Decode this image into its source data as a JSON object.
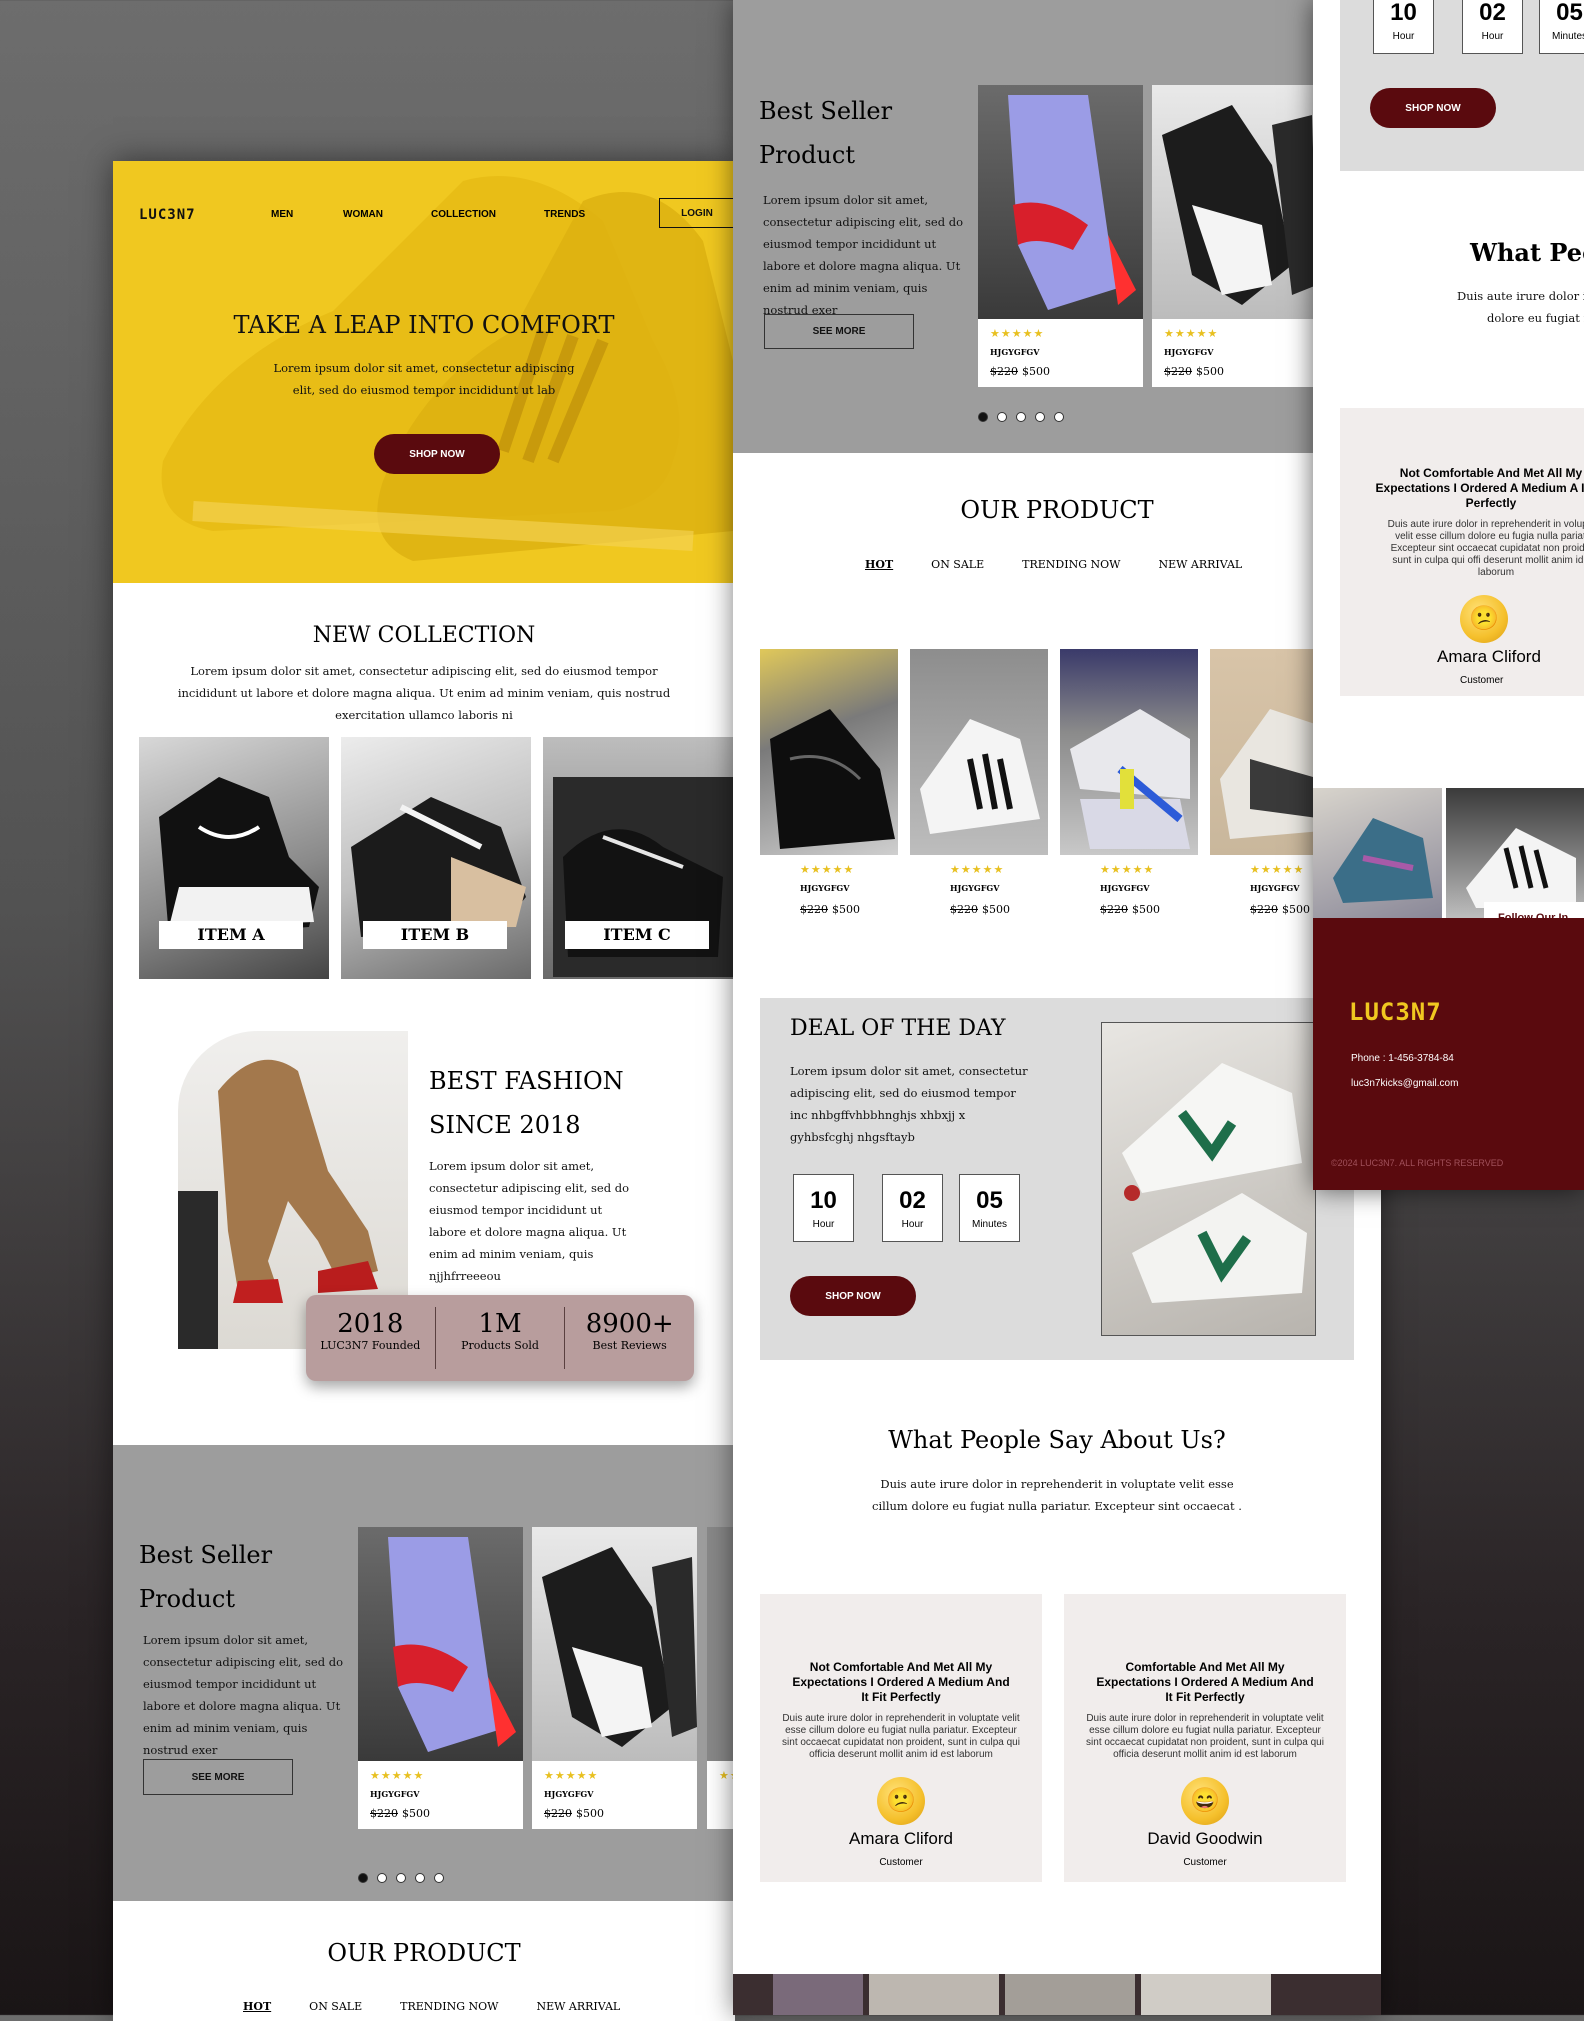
{
  "colors": {
    "accent": "#5a0a0e",
    "hero": "#f0c820",
    "gray": "#9d9d9d",
    "stats": "#b89d9d"
  },
  "brand": "LUC3N7",
  "nav": {
    "items": [
      "MEN",
      "WOMAN",
      "COLLECTION",
      "TRENDS"
    ],
    "login": "LOGIN"
  },
  "hero": {
    "title": "TAKE A LEAP INTO COMFORT",
    "text": "Lorem ipsum dolor sit amet, consectetur adipiscing elit, sed do eiusmod tempor incididunt ut lab",
    "cta": "SHOP NOW"
  },
  "collection": {
    "title": "NEW COLLECTION",
    "text": "Lorem ipsum dolor sit amet, consectetur adipiscing elit, sed do eiusmod tempor incididunt ut labore et dolore magna aliqua. Ut enim ad minim veniam, quis nostrud exercitation ullamco laboris ni",
    "items": [
      "ITEM A",
      "ITEM B",
      "ITEM C"
    ]
  },
  "fashion": {
    "title1": "BEST FASHION",
    "title2": "SINCE 2018",
    "text": "Lorem ipsum dolor sit amet, consectetur adipiscing elit, sed do eiusmod tempor incididunt ut labore et dolore magna aliqua. Ut enim ad minim veniam, quis njjhfrreeeou",
    "stats": [
      {
        "value": "2018",
        "label": "LUC3N7 Founded"
      },
      {
        "value": "1M",
        "label": "Products Sold"
      },
      {
        "value": "8900+",
        "label": "Best Reviews"
      }
    ]
  },
  "bestseller": {
    "title1": "Best Seller",
    "title2": "Product",
    "text": "Lorem ipsum dolor sit amet, consectetur adipiscing elit, sed do eiusmod tempor incididunt ut labore et dolore magna aliqua. Ut enim ad minim veniam, quis nostrud exer",
    "more": "SEE MORE",
    "code": "HJGYGFGV",
    "old_price": "$220",
    "price": "$500",
    "stars": "★★★★★"
  },
  "product": {
    "title": "OUR PRODUCT",
    "tabs": [
      "HOT",
      "ON SALE",
      "TRENDING NOW",
      "NEW ARRIVAL"
    ],
    "code": "HJGYGFGV",
    "old_price": "$220",
    "price": "$500"
  },
  "deal": {
    "title": "DEAL OF THE DAY",
    "text": "Lorem ipsum dolor sit amet, consectetur adipiscing elit, sed do eiusmod tempor inc nhbgffvhbbhnghjs  xhbxjj x gyhbsfcghj nhgsftayb",
    "timer": [
      {
        "value": "10",
        "label": "Hour"
      },
      {
        "value": "02",
        "label": "Hour"
      },
      {
        "value": "05",
        "label": "Minutes"
      }
    ],
    "cta": "SHOP NOW"
  },
  "reviews": {
    "title": "What People Say About Us?",
    "title_partial": "What Peo",
    "text": "Duis aute irure dolor in reprehenderit in voluptate velit esse cillum dolore eu fugiat nulla pariatur. Excepteur sint occaecat .",
    "text_partial1": "Duis aute irure dolor in",
    "text_partial2": "dolore eu fugiat nu",
    "items": [
      {
        "heading": "Not Comfortable And Met All My Expectations I Ordered A Medium And It Fit Perfectly",
        "body": "Duis aute irure dolor in reprehenderit in voluptate velit esse cillum dolore eu fugiat nulla pariatur. Excepteur sint occaecat cupidatat non proident, sunt in culpa qui officia deserunt mollit anim id est laborum",
        "name": "Amara Cliford",
        "role": "Customer",
        "face": "confused-face-icon"
      },
      {
        "heading": "Comfortable And Met All My Expectations I Ordered A Medium And It Fit Perfectly",
        "body": "Duis aute irure dolor in reprehenderit in voluptate velit esse cillum dolore eu fugiat nulla pariatur. Excepteur sint occaecat cupidatat non proident, sunt in culpa qui officia deserunt mollit anim id est laborum",
        "name": "David Goodwin",
        "role": "Customer",
        "face": "smiling-face-icon"
      }
    ],
    "partial_heading": "Not Comfortable And Met All My Expectations I Ordered A Medium A It Fit Perfectly",
    "partial_body": "Duis aute irure dolor in reprehenderit in voluptate velit esse cillum dolore eu fugia nulla pariatur. Excepteur sint occaecat cupidatat non proident, sunt in culpa qui offi deserunt mollit anim id est laborum"
  },
  "footer": {
    "follow": "Follow Our In",
    "phone": "Phone : 1-456-3784-84",
    "email": "luc3n7kicks@gmail.com",
    "copyright": "©2024 LUC3N7. ALL RIGHTS RESERVED"
  }
}
